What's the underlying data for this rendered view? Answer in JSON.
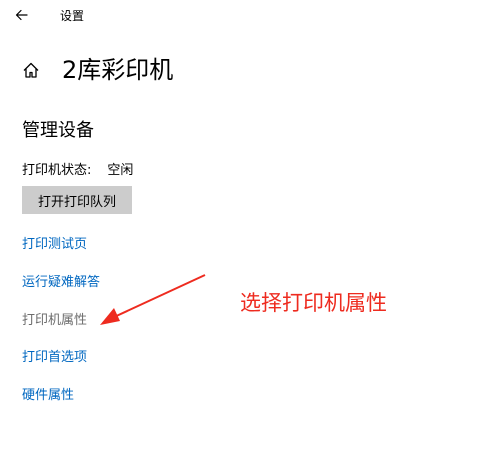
{
  "window": {
    "title": "设置"
  },
  "page": {
    "title": "2库彩印机"
  },
  "manage": {
    "heading": "管理设备",
    "status_label": "打印机状态:",
    "status_value": "空闲",
    "open_queue_label": "打开打印队列"
  },
  "links": [
    {
      "label": "打印测试页"
    },
    {
      "label": "运行疑难解答"
    },
    {
      "label": "打印机属性"
    },
    {
      "label": "打印首选项"
    },
    {
      "label": "硬件属性"
    }
  ],
  "annotation": {
    "text": "选择打印机属性",
    "color": "#ee2b1f"
  },
  "colors": {
    "link": "#0067c0",
    "button_bg": "#cccccc",
    "dimmed_link": "#6d6d6d"
  },
  "icons": {
    "back": "back-arrow-icon",
    "home": "home-icon"
  }
}
